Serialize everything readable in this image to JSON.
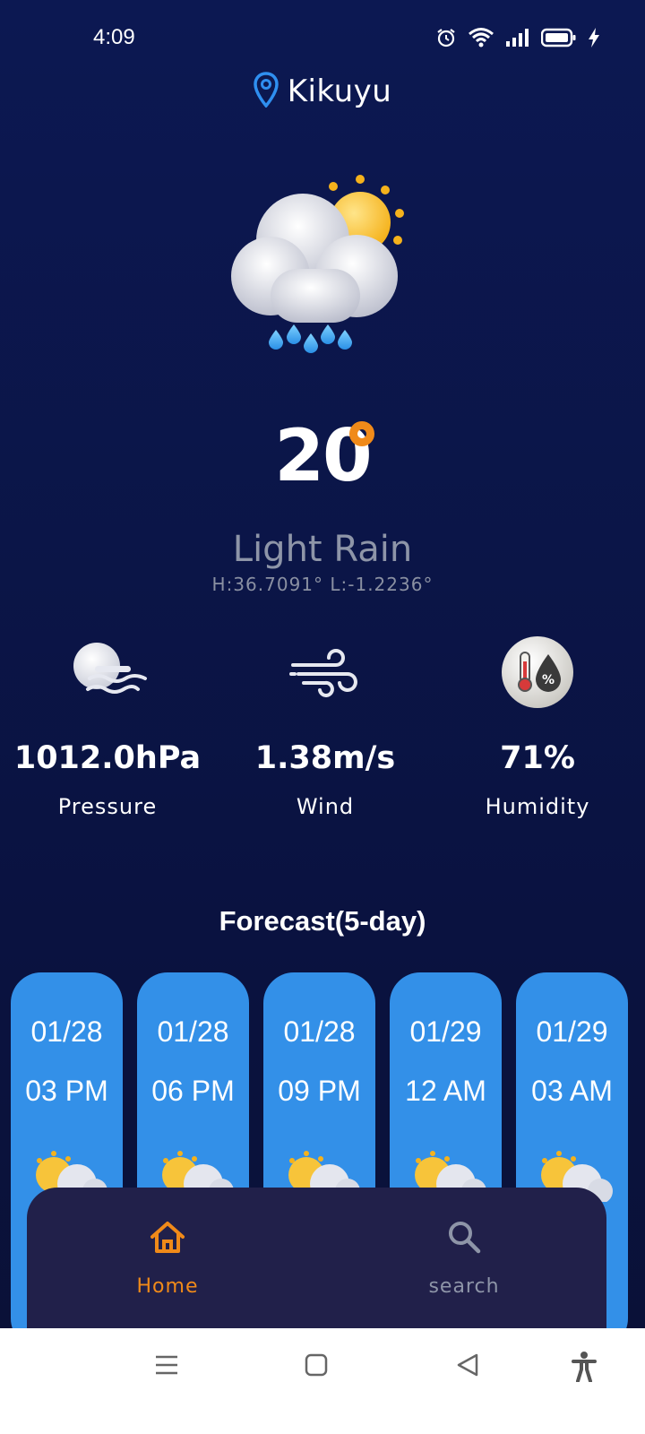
{
  "status_bar": {
    "time": "4:09",
    "icons": [
      "alarm-icon",
      "wifi-icon",
      "signal-icon",
      "battery-icon",
      "charging-icon"
    ]
  },
  "location": {
    "name": "Kikuyu",
    "icon": "location-pin-icon"
  },
  "current": {
    "icon": "cloud-sun-rain-icon",
    "temperature": "20",
    "condition": "Light Rain",
    "coords": "H:36.7091°  L:-1.2236°"
  },
  "stats": [
    {
      "icon": "pressure-icon",
      "value": "1012.0hPa",
      "label": "Pressure"
    },
    {
      "icon": "wind-icon",
      "value": "1.38m/s",
      "label": "Wind"
    },
    {
      "icon": "humidity-icon",
      "value": "71%",
      "label": "Humidity"
    }
  ],
  "forecast": {
    "title": "Forecast(5-day)",
    "items": [
      {
        "date": "01/28",
        "time": "03 PM",
        "icon": "partly-cloudy-icon"
      },
      {
        "date": "01/28",
        "time": "06 PM",
        "icon": "partly-cloudy-icon"
      },
      {
        "date": "01/28",
        "time": "09 PM",
        "icon": "partly-cloudy-icon"
      },
      {
        "date": "01/29",
        "time": "12 AM",
        "icon": "partly-cloudy-icon"
      },
      {
        "date": "01/29",
        "time": "03 AM",
        "icon": "partly-cloudy-icon"
      }
    ]
  },
  "nav": {
    "items": [
      {
        "label": "Home",
        "icon": "home-icon",
        "active": true
      },
      {
        "label": "search",
        "icon": "search-icon",
        "active": false
      }
    ]
  },
  "colors": {
    "background": "#0b1547",
    "accent": "#f08a19",
    "card": "#3390e8",
    "nav_bg": "#21204a",
    "inactive": "#8e95a8"
  },
  "system_nav": [
    "menu-icon",
    "home-square-icon",
    "back-icon",
    "accessibility-icon"
  ]
}
